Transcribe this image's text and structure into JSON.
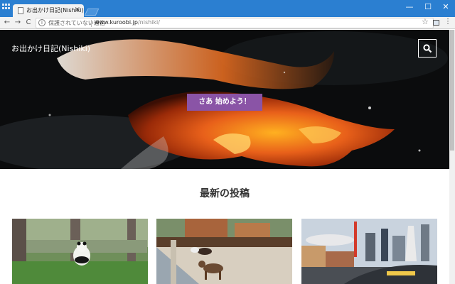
{
  "browser": {
    "tab_title": "お出かけ日記(Nishiki)",
    "tab_close": "×",
    "window_minimize": "—",
    "window_maximize": "☐",
    "window_close": "✕",
    "nav_back": "←",
    "nav_forward": "→",
    "nav_reload": "C",
    "security_text": "保護されていない通信",
    "url_host": "www.kuroobi.jp",
    "url_path": "/nishiki/",
    "star": "☆",
    "menu": "⋮"
  },
  "hero": {
    "site_title": "お出かけ日記(Nishiki)",
    "cta_label": "さあ 始めよう！"
  },
  "main": {
    "section_title": "最新の投稿"
  },
  "colors": {
    "titlebar": "#2b7fd1",
    "cta": "#8a54a6"
  }
}
